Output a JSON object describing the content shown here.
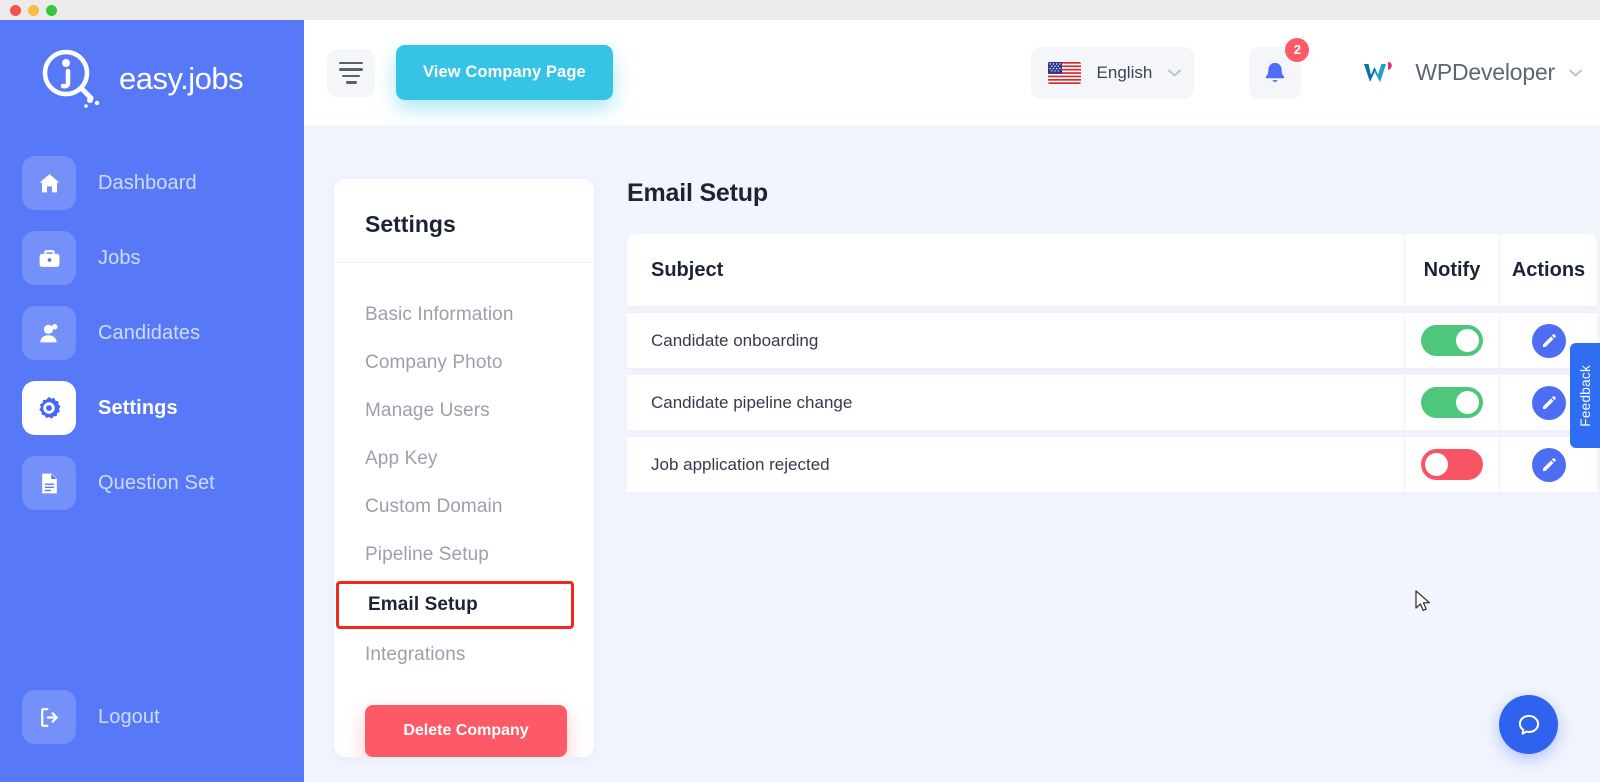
{
  "window": {
    "traffic_lights": [
      "close",
      "minimize",
      "maximize"
    ]
  },
  "brand": {
    "logo_text": "easy.jobs"
  },
  "sidebar": {
    "items": [
      {
        "label": "Dashboard",
        "icon": "home-icon",
        "active": false
      },
      {
        "label": "Jobs",
        "icon": "briefcase-icon",
        "active": false
      },
      {
        "label": "Candidates",
        "icon": "user-icon",
        "active": false
      },
      {
        "label": "Settings",
        "icon": "gear-icon",
        "active": true
      },
      {
        "label": "Question Set",
        "icon": "document-icon",
        "active": false
      }
    ],
    "logout": {
      "label": "Logout",
      "icon": "logout-icon"
    }
  },
  "topbar": {
    "menu_toggle_icon": "hamburger-icon",
    "view_company_label": "View Company Page",
    "language": {
      "label": "English",
      "flag": "us-flag-icon",
      "chevron": "chevron-down-icon"
    },
    "notifications": {
      "icon": "bell-icon",
      "count": "2"
    },
    "user": {
      "name": "WPDeveloper",
      "logo": "wpdeveloper-logo",
      "chevron": "chevron-down-icon"
    }
  },
  "settings_card": {
    "title": "Settings",
    "items": [
      {
        "label": "Basic Information",
        "highlighted": false
      },
      {
        "label": "Company Photo",
        "highlighted": false
      },
      {
        "label": "Manage Users",
        "highlighted": false
      },
      {
        "label": "App Key",
        "highlighted": false
      },
      {
        "label": "Custom Domain",
        "highlighted": false
      },
      {
        "label": "Pipeline Setup",
        "highlighted": false
      },
      {
        "label": "Email Setup",
        "highlighted": true
      },
      {
        "label": "Integrations",
        "highlighted": false
      }
    ],
    "delete_label": "Delete Company"
  },
  "panel": {
    "title": "Email Setup",
    "table": {
      "columns": [
        "Subject",
        "Notify",
        "Actions"
      ],
      "rows": [
        {
          "subject": "Candidate onboarding",
          "notify": "on",
          "action_icon": "edit-pencil-icon"
        },
        {
          "subject": "Candidate pipeline change",
          "notify": "on",
          "action_icon": "edit-pencil-icon"
        },
        {
          "subject": "Job application rejected",
          "notify": "off",
          "action_icon": "edit-pencil-icon"
        }
      ]
    }
  },
  "feedback_tab": {
    "label": "Feedback"
  },
  "chat_button": {
    "icon": "chat-bubble-icon"
  },
  "colors": {
    "sidebar": "#5779f8",
    "accent_cyan": "#35c3e6",
    "accent_red": "#fb5a66",
    "toggle_on": "#4ec77d",
    "toggle_off": "#f85464",
    "edit_blue": "#4d6ef2",
    "highlight_border": "#f0281e",
    "background": "#f2f5fd"
  }
}
